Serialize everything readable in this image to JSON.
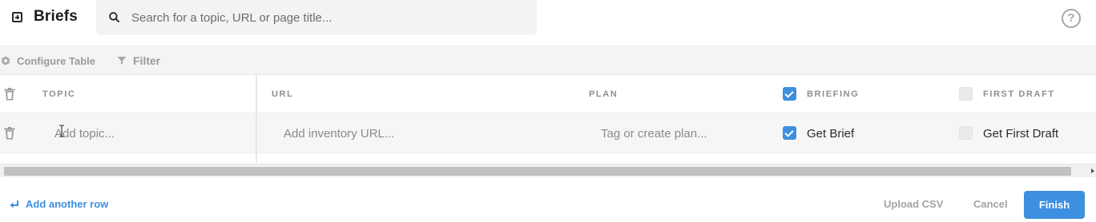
{
  "header": {
    "title": "Briefs",
    "brand_icon": "plus-square-icon",
    "search_placeholder": "Search for a topic, URL or page title...",
    "help_glyph": "?"
  },
  "toolbar": {
    "configure_label": "Configure Table",
    "filter_label": "Filter"
  },
  "table": {
    "columns": {
      "topic": "TOPIC",
      "url": "URL",
      "plan": "PLAN",
      "briefing": "BRIEFING",
      "first_draft": "FIRST DRAFT"
    },
    "header_checkboxes": {
      "briefing_checked": true,
      "first_draft_checked": false
    },
    "rows": [
      {
        "topic_placeholder": "Add topic...",
        "url_placeholder": "Add inventory URL...",
        "plan_placeholder": "Tag or create plan...",
        "briefing_label": "Get Brief",
        "briefing_checked": true,
        "first_draft_label": "Get First Draft",
        "first_draft_checked": false
      }
    ]
  },
  "footer": {
    "add_row_label": "Add another row",
    "upload_label": "Upload CSV",
    "cancel_label": "Cancel",
    "finish_label": "Finish"
  },
  "colors": {
    "accent": "#3d8fe0",
    "muted_text": "#9a9a9a",
    "toolbar_bg": "#f4f4f4"
  }
}
